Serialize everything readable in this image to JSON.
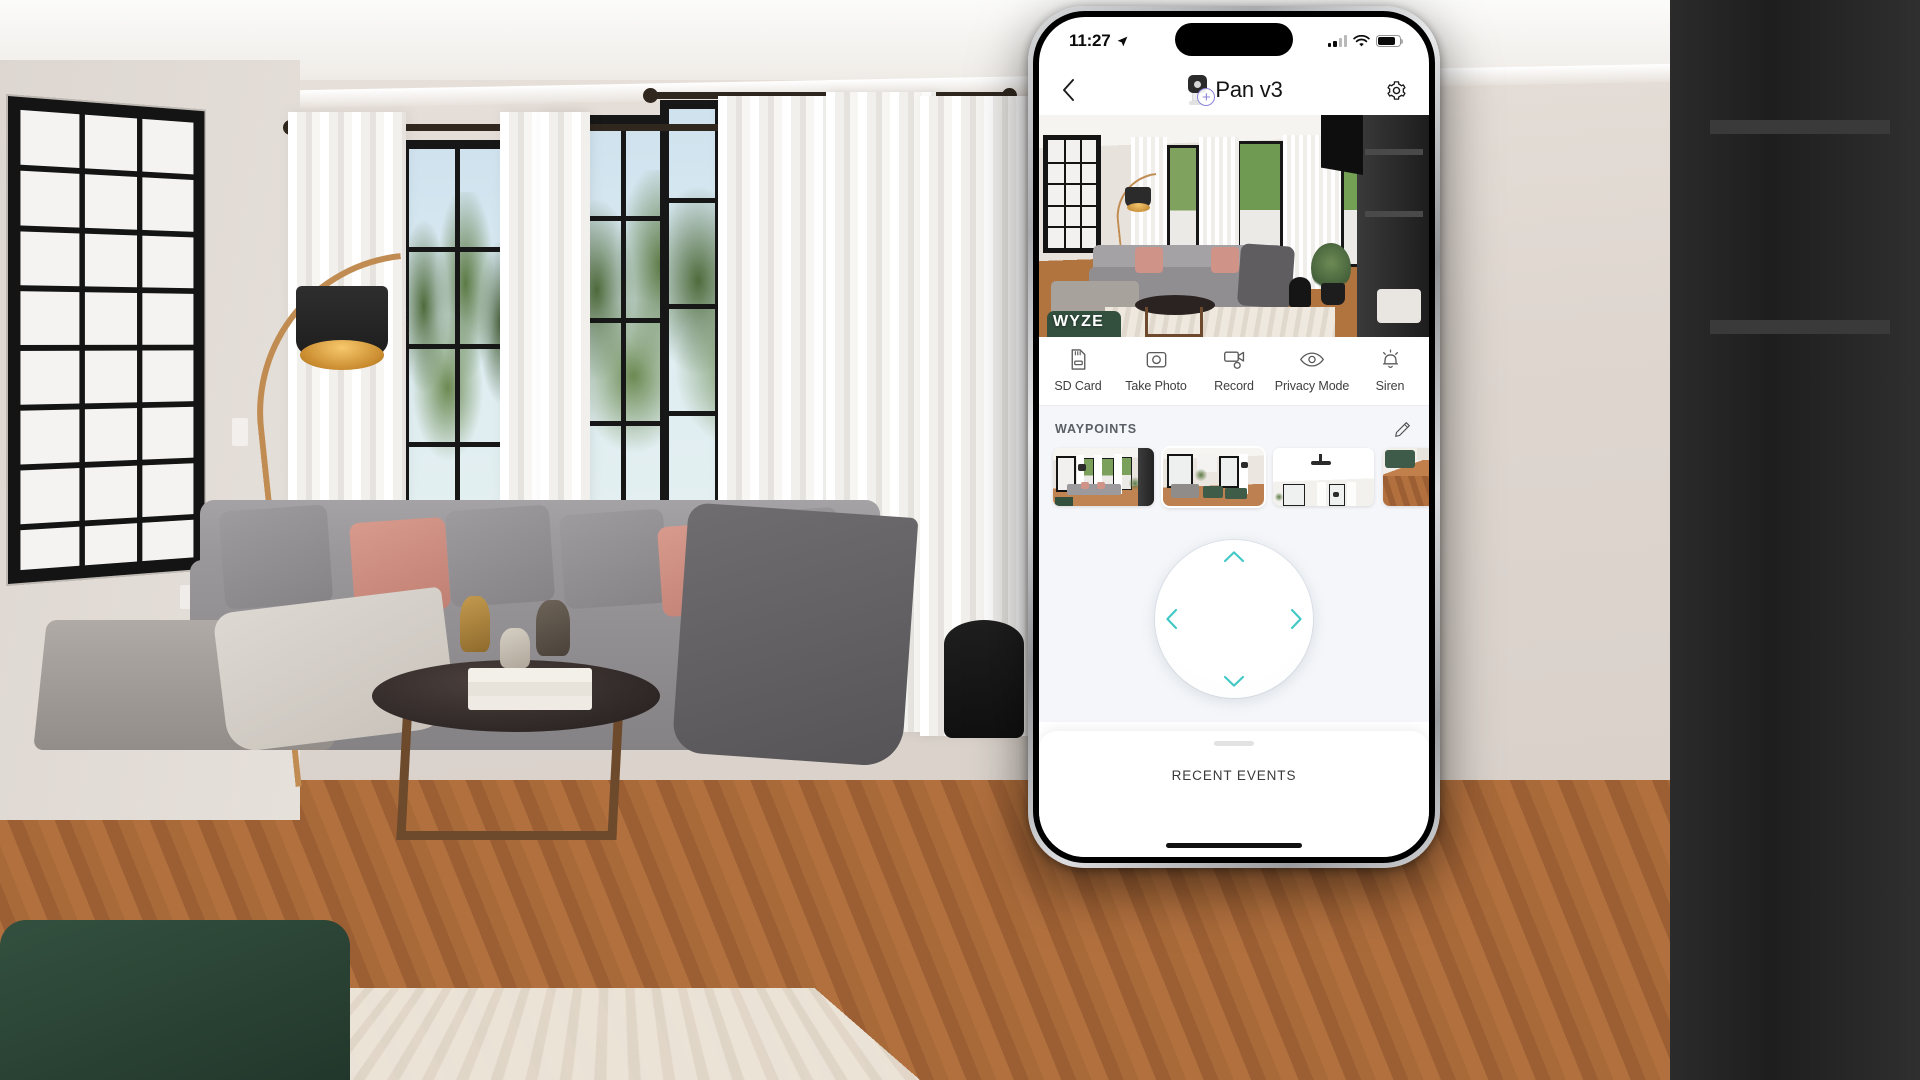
{
  "status_bar": {
    "time": "11:27",
    "location_icon": "location-arrow-icon",
    "signal_icon": "cellular-signal-icon",
    "wifi_icon": "wifi-icon",
    "battery_icon": "battery-icon"
  },
  "nav": {
    "back_icon": "chevron-left-icon",
    "device_icon": "camera-device-icon",
    "add_badge": "+",
    "title": "Pan v3",
    "settings_icon": "gear-icon"
  },
  "feed": {
    "watermark": "WYZE"
  },
  "controls": [
    {
      "label": "SD Card",
      "icon": "sd-card-icon"
    },
    {
      "label": "Take Photo",
      "icon": "camera-icon"
    },
    {
      "label": "Record",
      "icon": "video-record-icon"
    },
    {
      "label": "Privacy Mode",
      "icon": "eye-icon"
    },
    {
      "label": "Siren",
      "icon": "bell-siren-icon"
    }
  ],
  "waypoints": {
    "title": "WAYPOINTS",
    "edit_icon": "pencil-edit-icon",
    "items": [
      {
        "name": "waypoint-1",
        "caption": ""
      },
      {
        "name": "waypoint-2",
        "caption": ""
      },
      {
        "name": "waypoint-3",
        "caption": ""
      },
      {
        "name": "waypoint-4",
        "caption": ""
      }
    ]
  },
  "dpad": {
    "up_icon": "chevron-up-icon",
    "down_icon": "chevron-down-icon",
    "left_icon": "chevron-left-icon",
    "right_icon": "chevron-right-icon",
    "accent_color": "#3fc8c4"
  },
  "bottom_sheet": {
    "grabber": "drag-handle",
    "title": "RECENT EVENTS"
  },
  "colors": {
    "accent_teal": "#3fc8c4",
    "badge_purple": "#8b83d9",
    "panel_bg": "#f4f6f9",
    "text_dark": "#141414"
  }
}
